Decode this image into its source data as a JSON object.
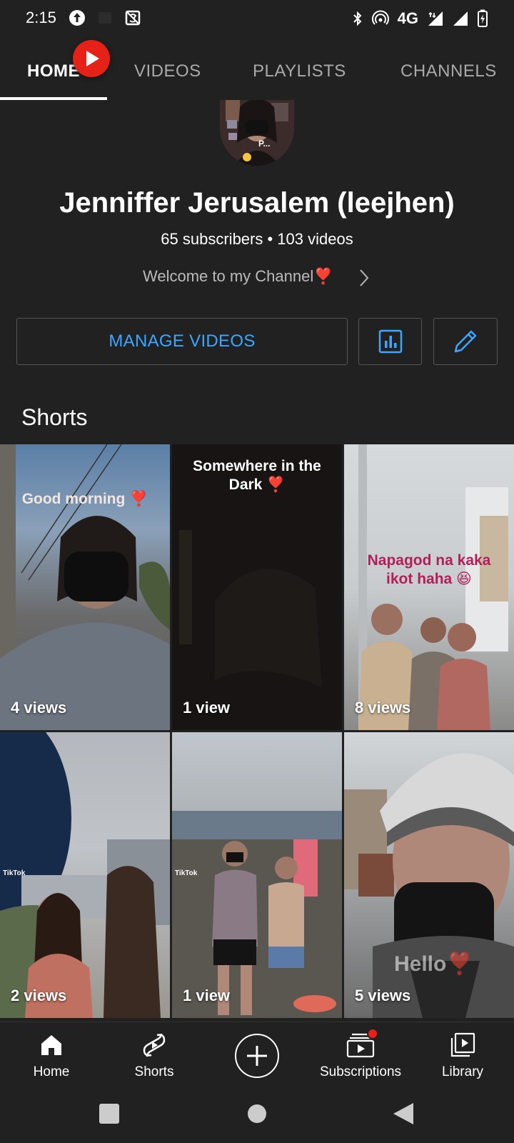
{
  "status_bar": {
    "time": "2:15",
    "network": "4G"
  },
  "tabs": [
    {
      "label": "HOME",
      "active": true
    },
    {
      "label": "VIDEOS",
      "active": false
    },
    {
      "label": "PLAYLISTS",
      "active": false
    },
    {
      "label": "CHANNELS",
      "active": false
    }
  ],
  "channel": {
    "avatar_text": "P...",
    "name": "Jenniffer Jerusalem (leejhen)",
    "stats": "65 subscribers • 103 videos",
    "description": "Welcome to my Channel❣️"
  },
  "actions": {
    "manage_label": "MANAGE VIDEOS"
  },
  "shorts": {
    "title": "Shorts",
    "items": [
      {
        "overlay": "Good morning ❣️",
        "views": "4 views"
      },
      {
        "overlay": "Somewhere in the Dark ❣️",
        "views": "1 view"
      },
      {
        "overlay": "Napagod na kaka ikot haha 😆",
        "views": "8 views"
      },
      {
        "overlay": "",
        "views": "2 views",
        "watermark": "TikTok"
      },
      {
        "overlay": "",
        "views": "1 view",
        "watermark": "TikTok"
      },
      {
        "overlay": "Hello❣️",
        "views": "5 views"
      }
    ]
  },
  "bottom_nav": [
    {
      "label": "Home"
    },
    {
      "label": "Shorts"
    },
    {
      "label": "Subscriptions"
    },
    {
      "label": "Library"
    }
  ],
  "colors": {
    "background": "#212121",
    "accent_blue": "#3ea6ff",
    "brand_red": "#e62117"
  }
}
